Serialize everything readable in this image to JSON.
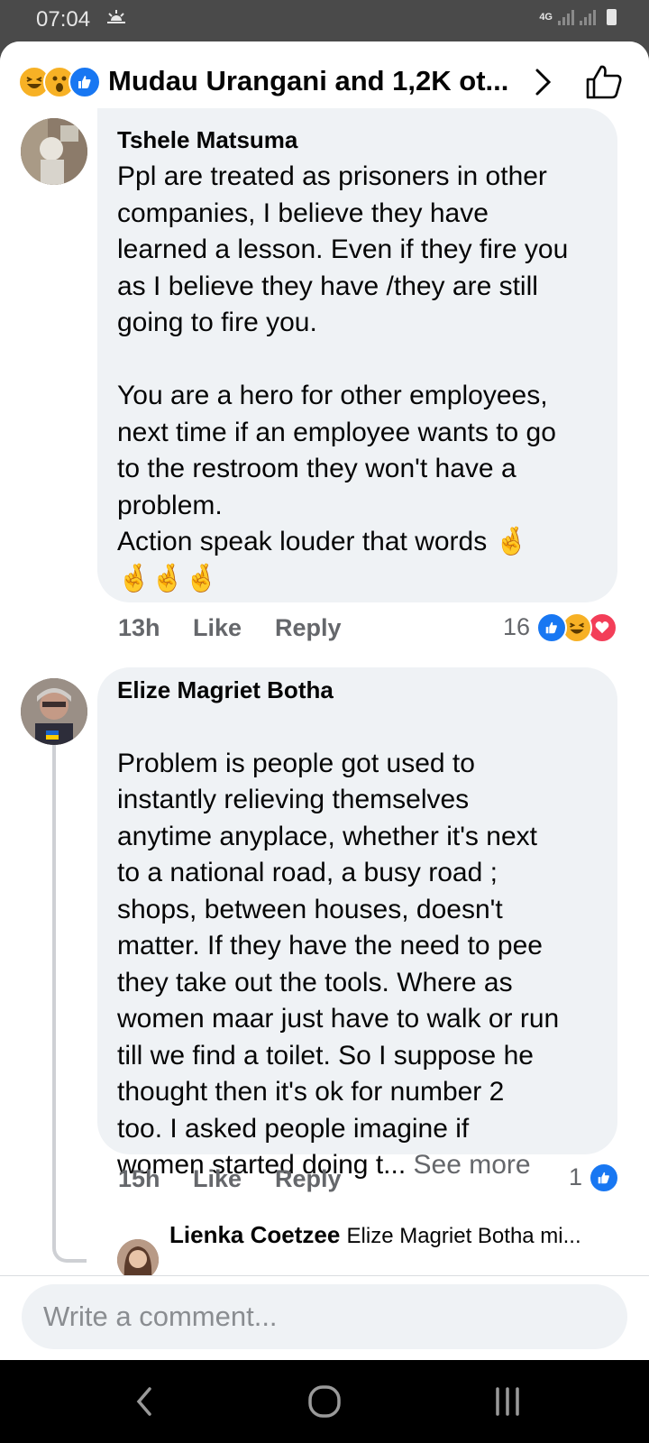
{
  "status_bar": {
    "time": "07:04",
    "weather_icon": "sunrise-icon",
    "network": "4G"
  },
  "header": {
    "reaction_icons": [
      "haha-icon",
      "wow-icon",
      "like-icon"
    ],
    "title": "Mudau Urangani and 1,2K ot...",
    "next_icon": "chevron-right-icon",
    "like_icon": "thumbs-up-outline-icon"
  },
  "comments": [
    {
      "author": "Tshele Matsuma",
      "text": "Ppl are treated as prisoners in other\ncompanies, I believe they have\nlearned a lesson. Even if they fire you\nas I believe they have /they are still\ngoing to fire you.\n\nYou are a hero for other employees,\nnext time if an employee wants to go\nto the restroom they won't have a\nproblem.\nAction speak louder that words 🤞\n🤞🤞🤞",
      "time": "13h",
      "like_label": "Like",
      "reply_label": "Reply",
      "reaction_count": "16",
      "reaction_types": [
        "like",
        "haha",
        "love"
      ]
    },
    {
      "author": "Elize Magriet Botha",
      "text": "Problem is people got used to\ninstantly  relieving themselves\nanytime anyplace, whether it's next\nto a national road, a busy road ;\nshops, between houses, doesn't\nmatter.  If they have the need to pee\nthey take out the tools.  Where as\nwomen maar just have to walk or run\ntill we find a toilet.  So I suppose he\nthought then it's ok for number  2\ntoo.  I asked people imagine if\nwomen started doing t...",
      "see_more": "See more",
      "time": "15h",
      "like_label": "Like",
      "reply_label": "Reply",
      "reaction_count": "1",
      "reaction_types": [
        "like"
      ]
    }
  ],
  "reply_preview": {
    "author": "Lienka Coetzee",
    "text": "Elize Magriet Botha mi..."
  },
  "composer": {
    "placeholder": "Write a comment..."
  },
  "nav": {
    "back_icon": "back-chevron-icon",
    "home_icon": "home-circle-icon",
    "recents_icon": "recents-bars-icon"
  },
  "colors": {
    "like_blue": "#1877f2",
    "haha_yellow": "#f7b125",
    "love_red": "#f33e58",
    "bubble_bg": "#eff2f5",
    "muted_text": "#65676b"
  }
}
